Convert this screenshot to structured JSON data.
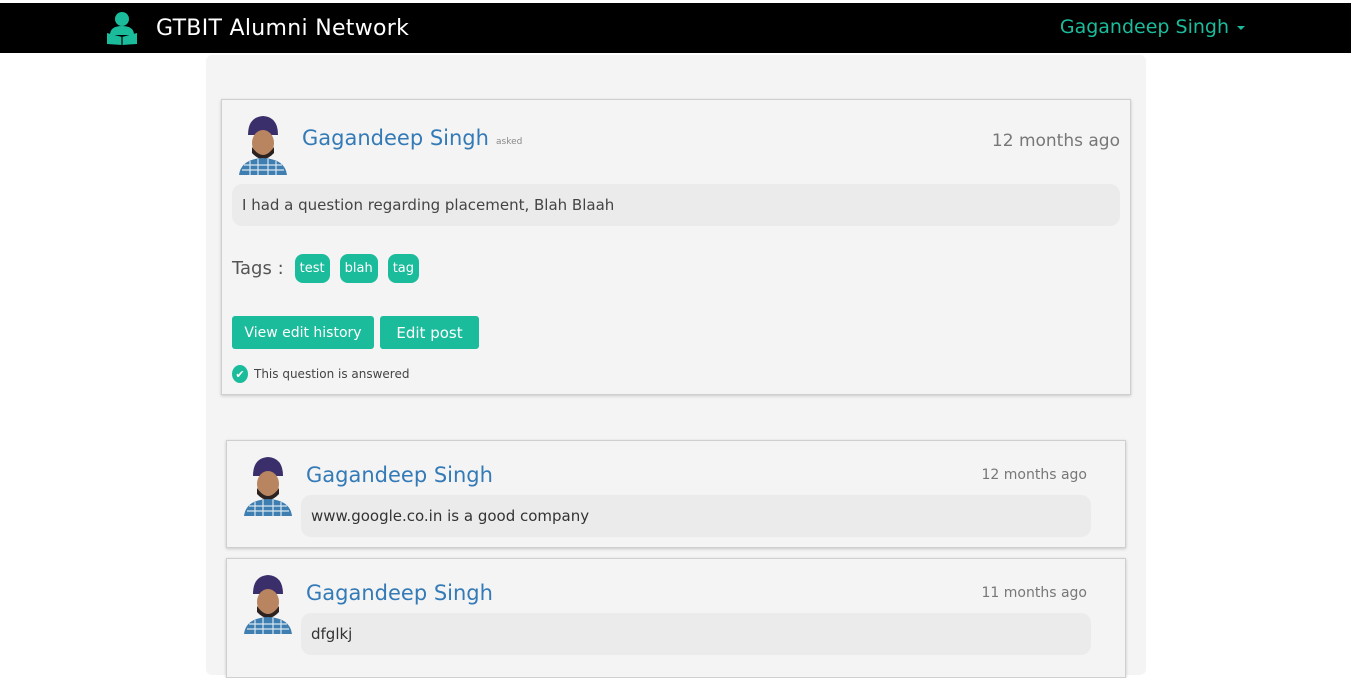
{
  "navbar": {
    "brand_icon": "reader-person-icon",
    "brand_title": "GTBIT Alumni Network",
    "user_name": "Gagandeep Singh",
    "accent_color": "#1bbc9b"
  },
  "question": {
    "author": "Gagandeep Singh",
    "asked_label": "asked",
    "time": "12 months ago",
    "body": "I had a question regarding placement, Blah Blaah",
    "tags_label": "Tags :",
    "tags": [
      "test",
      "blah",
      "tag"
    ],
    "view_history_label": "View edit history",
    "edit_label": "Edit post",
    "answered_text": "This question is answered",
    "answered_icon": "check-circle-icon"
  },
  "answers": [
    {
      "author": "Gagandeep Singh",
      "time": "12 months ago",
      "body": "www.google.co.in is a good company"
    },
    {
      "author": "Gagandeep Singh",
      "time": "11 months ago",
      "body": "dfglkj"
    }
  ]
}
